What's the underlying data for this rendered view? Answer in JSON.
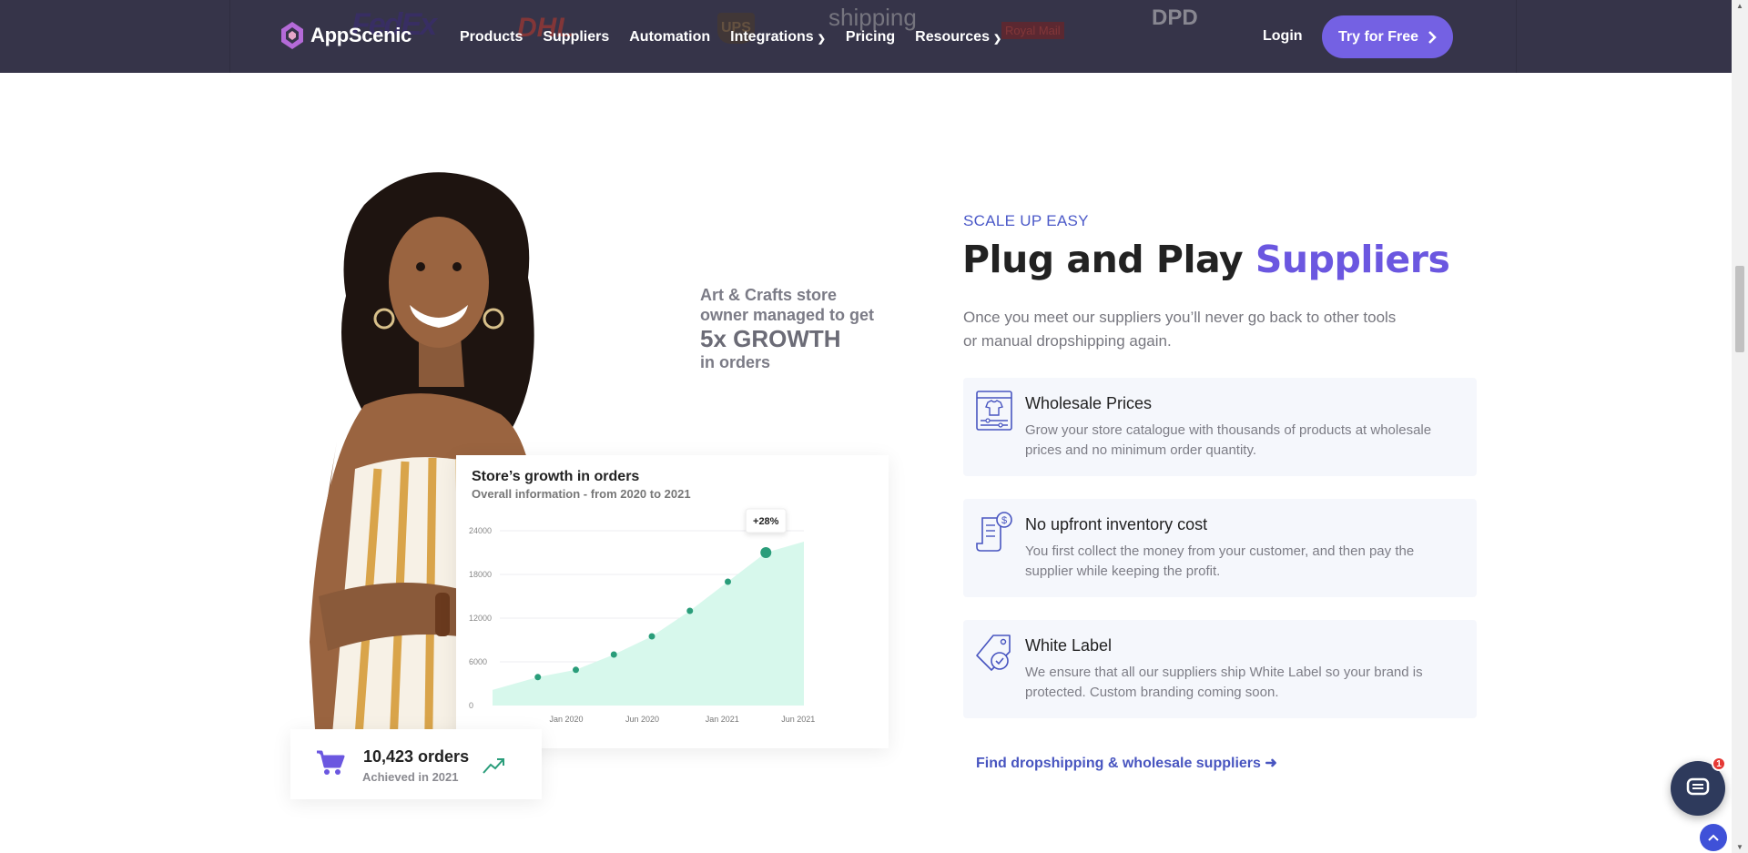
{
  "header": {
    "brand": "AppScenic",
    "nav": [
      {
        "label": "Products",
        "dropdown": false
      },
      {
        "label": "Suppliers",
        "dropdown": false
      },
      {
        "label": "Automation",
        "dropdown": false
      },
      {
        "label": "Integrations",
        "dropdown": true
      },
      {
        "label": "Pricing",
        "dropdown": false
      },
      {
        "label": "Resources",
        "dropdown": true
      }
    ],
    "login": "Login",
    "cta": "Try for Free",
    "partner_logos": [
      "FedEx",
      "DHL",
      "UPS",
      "shipping",
      "Royal Mail",
      "DPD"
    ]
  },
  "hero": {
    "stat": {
      "line1": "Art & Crafts store",
      "line2": "owner managed to get",
      "big": "5x GROWTH",
      "line3": "in orders"
    },
    "orders": {
      "value": "10,423 orders",
      "label": "Achieved in 2021"
    }
  },
  "chart_data": {
    "type": "area",
    "title": "Store’s growth in orders",
    "subtitle": "Overall information - from 2020 to 2021",
    "x_ticks": [
      "Jan 2020",
      "Jun 2020",
      "Jan 2021",
      "Jun 2021"
    ],
    "y_ticks": [
      "24000",
      "18000",
      "12000",
      "6000",
      "0"
    ],
    "ylim": [
      0,
      24000
    ],
    "points": [
      {
        "x": 1,
        "y": 3900
      },
      {
        "x": 2,
        "y": 4900
      },
      {
        "x": 3,
        "y": 7000
      },
      {
        "x": 4,
        "y": 9500
      },
      {
        "x": 5,
        "y": 13000
      },
      {
        "x": 6,
        "y": 17000
      },
      {
        "x": 7,
        "y": 21000
      }
    ],
    "annotation": "+28%",
    "colors": {
      "fill": "#d7f8ec",
      "point": "#2a9d7a"
    }
  },
  "content": {
    "eyebrow": "SCALE UP EASY",
    "headline_plain": "Plug and Play ",
    "headline_accent": "Suppliers",
    "intro": "Once you meet our suppliers you’ll never go back to other tools or manual dropshipping again.",
    "features": [
      {
        "title": "Wholesale Prices",
        "desc": "Grow your store catalogue with thousands of products at wholesale prices and no minimum order quantity.",
        "icon": "tshirt-catalog-icon"
      },
      {
        "title": "No upfront inventory cost",
        "desc": "You first collect the money from your customer, and then pay the supplier while keeping the profit.",
        "icon": "invoice-dollar-icon"
      },
      {
        "title": "White Label",
        "desc": "We ensure that all our suppliers ship White Label so your brand is protected. Custom branding coming soon.",
        "icon": "tag-check-icon"
      }
    ],
    "link": "Find dropshipping & wholesale suppliers",
    "accent_color": "#6b57e0"
  },
  "widgets": {
    "chat_badge": "1"
  }
}
